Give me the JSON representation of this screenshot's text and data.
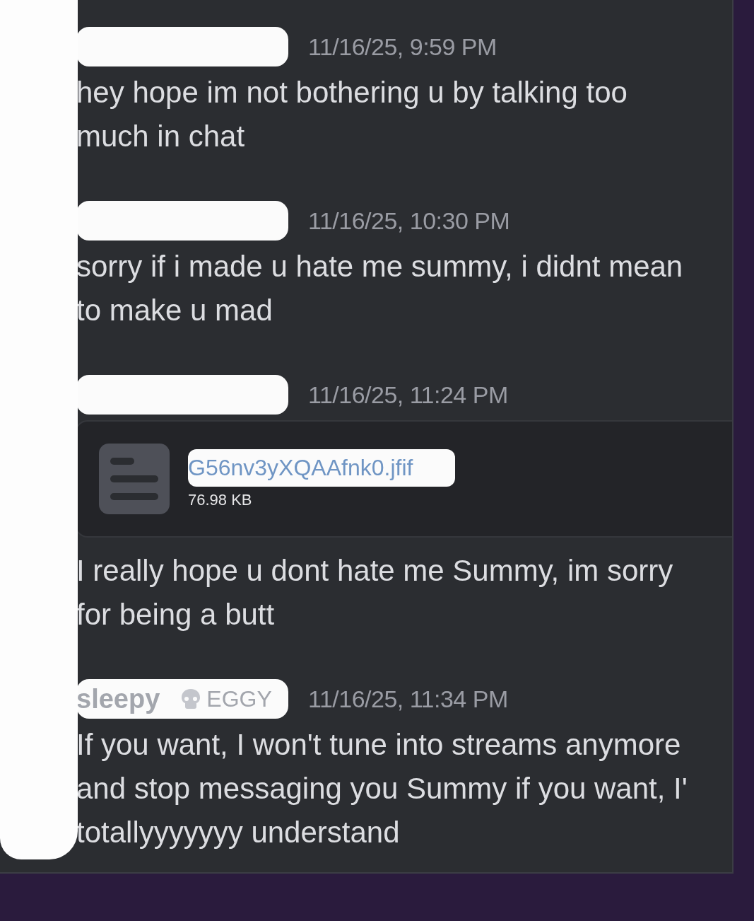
{
  "messages": [
    {
      "author": {
        "redacted": true
      },
      "timestamp": "11/16/25, 9:59 PM",
      "lines": [
        "hey hope im not bothering u by talking too",
        "much in chat"
      ]
    },
    {
      "author": {
        "redacted": true
      },
      "timestamp": "11/16/25, 10:30 PM",
      "lines": [
        "sorry if i made u hate me summy, i didnt mean",
        "to make u mad"
      ]
    },
    {
      "author": {
        "redacted": true
      },
      "timestamp": "11/16/25, 11:24 PM",
      "attachment": {
        "filename": "G56nv3yXQAAfnk0.jfif",
        "size": "76.98 KB"
      },
      "lines": [
        "I really hope u dont hate me Summy, im sorry",
        "for being a butt"
      ]
    },
    {
      "author": {
        "redacted": true,
        "name": "sleepy",
        "tag": "EGGY"
      },
      "timestamp": "11/16/25, 11:34 PM",
      "lines": [
        "If you want, I won't tune into streams anymore",
        "and stop messaging you Summy if you want, I'",
        "totallyyyyyyy understand"
      ]
    }
  ]
}
